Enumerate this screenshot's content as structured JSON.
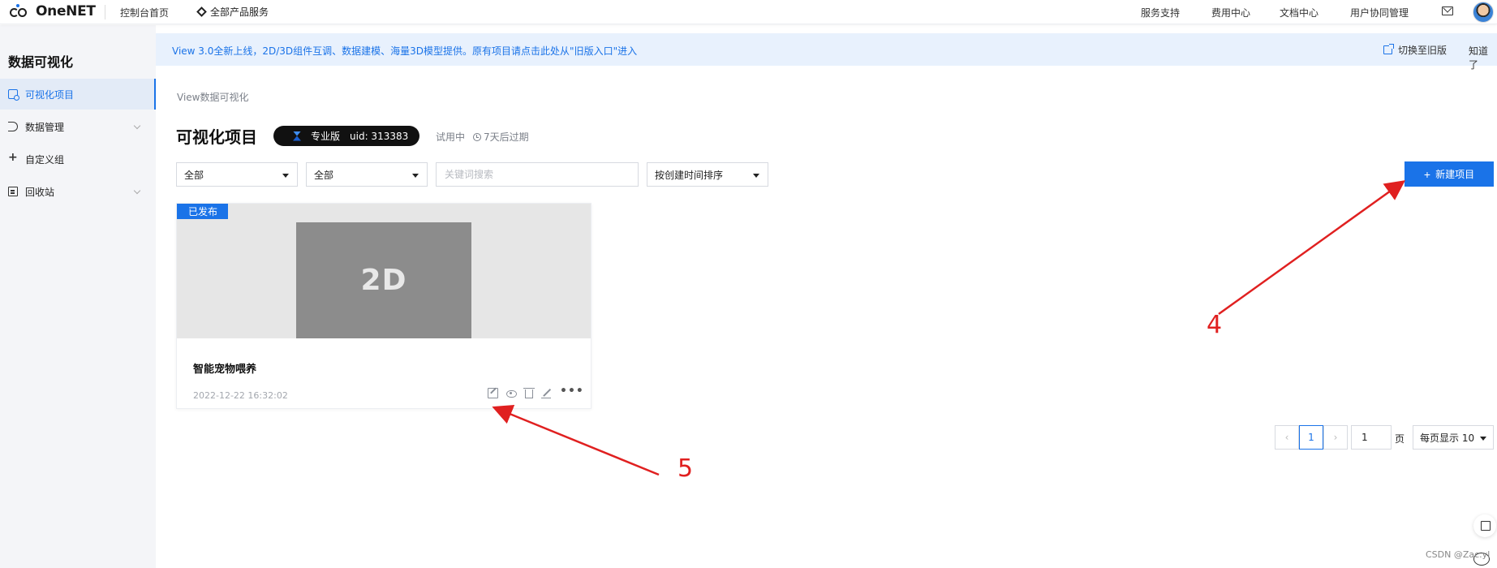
{
  "topbar": {
    "brand": "OneNET",
    "console_home": "控制台首页",
    "all_products": "全部产品服务",
    "service_support": "服务支持",
    "billing_center": "费用中心",
    "docs_center": "文档中心",
    "user_collab": "用户协同管理"
  },
  "sidebar": {
    "title": "数据可视化",
    "items": [
      {
        "label": "可视化项目",
        "icon": "project-icon",
        "active": true
      },
      {
        "label": "数据管理",
        "icon": "data-icon",
        "expandable": true
      },
      {
        "label": "自定义组",
        "icon": "group-icon"
      },
      {
        "label": "回收站",
        "icon": "recycle-bin-icon",
        "expandable": true
      }
    ]
  },
  "banner": {
    "text": "View 3.0全新上线，2D/3D组件互调、数据建模、海量3D模型提供。原有项目请点击此处从\"旧版入口\"进入",
    "switch_label": "切换至旧版",
    "dismiss_label": "知道了"
  },
  "main": {
    "breadcrumb": "View数据可视化",
    "title": "可视化项目",
    "edition": "专业版",
    "uid": "uid: 313383",
    "trial_status": "试用中",
    "expire_text": "7天后过期",
    "filter1": "全部",
    "filter2": "全部",
    "search_placeholder": "关键词搜索",
    "sort": "按创建时间排序",
    "new_project": "新建项目"
  },
  "card": {
    "status": "已发布",
    "thumb_label": "2D",
    "title": "智能宠物喂养",
    "date": "2022-12-22 16:32:02"
  },
  "pagination": {
    "prev": "‹",
    "current": "1",
    "next": "›",
    "jump_value": "1",
    "page_label": "页",
    "page_size": "每页显示 10"
  },
  "annotations": {
    "label_4": "4",
    "label_5": "5"
  },
  "watermark": "CSDN @Zac.yl",
  "colors": {
    "accent": "#1a73e8",
    "annotation": "#e02020"
  }
}
